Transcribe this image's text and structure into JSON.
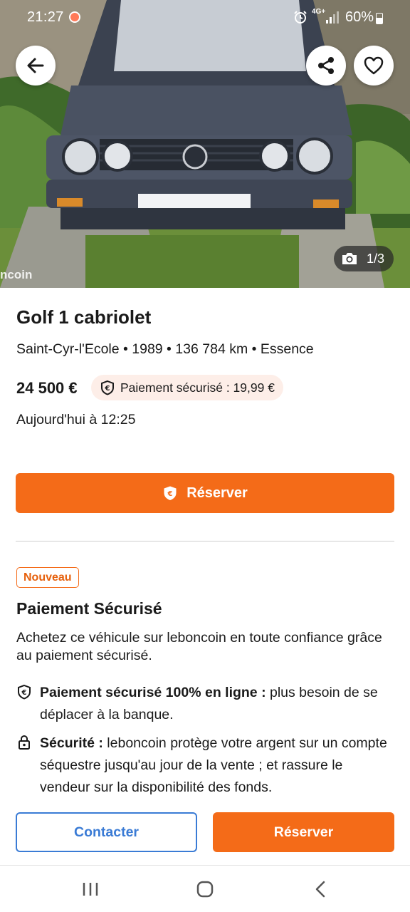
{
  "status_bar": {
    "time": "21:27",
    "network": "4G+",
    "battery": "60%"
  },
  "photo": {
    "counter": "1/3",
    "watermark": "ncoin"
  },
  "listing": {
    "title": "Golf 1 cabriolet",
    "subtitle": "Saint-Cyr-l'Ecole • 1989 • 136 784 km • Essence",
    "price": "24 500 €",
    "secure_badge": "Paiement sécurisé : 19,99 €",
    "date": "Aujourd'hui à 12:25",
    "reserve_label": "Réserver"
  },
  "secure_section": {
    "badge": "Nouveau",
    "title": "Paiement Sécurisé",
    "description": "Achetez ce véhicule sur leboncoin en toute confiance grâce au paiement sécurisé.",
    "features": [
      {
        "bold": "Paiement sécurisé 100% en ligne :",
        "text": " plus besoin de se déplacer à la banque."
      },
      {
        "bold": "Sécurité :",
        "text": " leboncoin protège votre argent sur un compte séquestre jusqu'au jour de la vente ; et rassure le vendeur sur la disponibilité des fonds."
      }
    ]
  },
  "action_bar": {
    "contact_label": "Contacter",
    "reserve_label": "Réserver"
  },
  "colors": {
    "accent_orange": "#f46b18",
    "contact_blue": "#3a7bd5",
    "badge_bg": "#fdeee8"
  },
  "icons": {
    "back": "arrow-left-icon",
    "share": "share-icon",
    "favorite": "heart-icon",
    "camera": "camera-icon",
    "secure": "euro-shield-icon",
    "lock": "lock-icon"
  }
}
